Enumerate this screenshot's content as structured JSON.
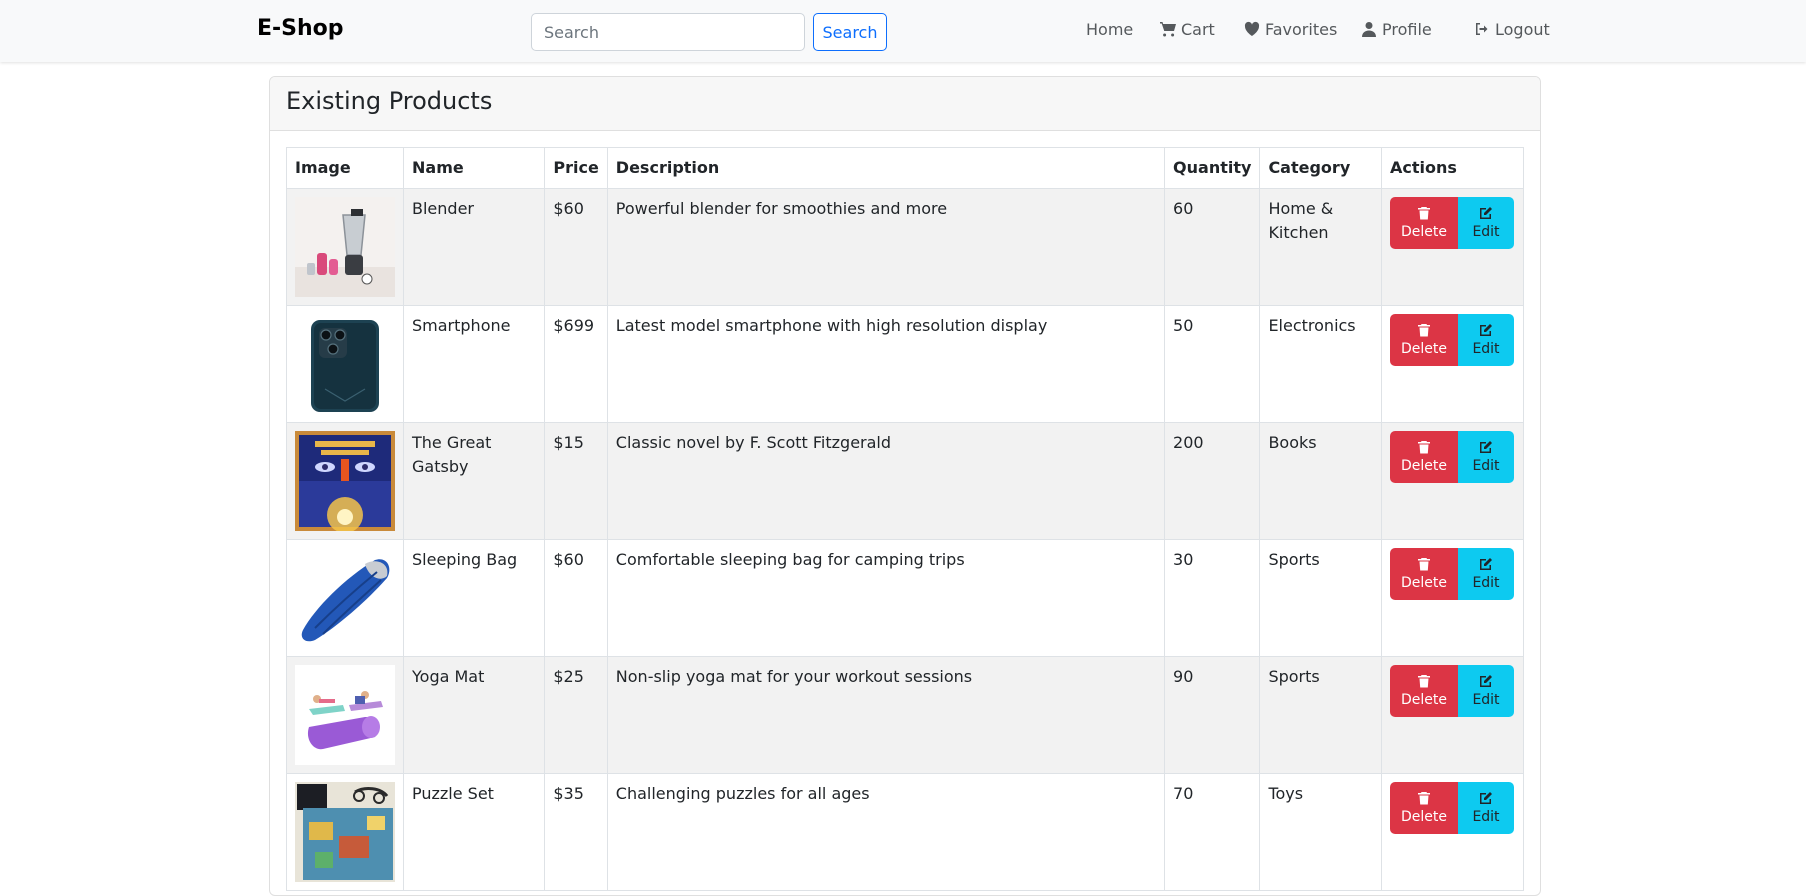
{
  "navbar": {
    "brand": "E-Shop",
    "search_placeholder": "Search",
    "search_button": "Search",
    "links": {
      "home": "Home",
      "cart": "Cart",
      "favorites": "Favorites",
      "profile": "Profile",
      "logout": "Logout"
    }
  },
  "products_card": {
    "title": "Existing Products",
    "columns": [
      "Image",
      "Name",
      "Price",
      "Description",
      "Quantity",
      "Category",
      "Actions"
    ],
    "delete_label": "Delete",
    "edit_label": "Edit",
    "rows": [
      {
        "name": "Blender",
        "price": "$60",
        "description": "Powerful blender for smoothies and more",
        "quantity": "60",
        "category": "Home & Kitchen",
        "image": "blender-photo"
      },
      {
        "name": "Smartphone",
        "price": "$699",
        "description": "Latest model smartphone with high resolution display",
        "quantity": "50",
        "category": "Electronics",
        "image": "smartphone-photo"
      },
      {
        "name": "The Great Gatsby",
        "price": "$15",
        "description": "Classic novel by F. Scott Fitzgerald",
        "quantity": "200",
        "category": "Books",
        "image": "book-cover-photo"
      },
      {
        "name": "Sleeping Bag",
        "price": "$60",
        "description": "Comfortable sleeping bag for camping trips",
        "quantity": "30",
        "category": "Sports",
        "image": "sleeping-bag-photo"
      },
      {
        "name": "Yoga Mat",
        "price": "$25",
        "description": "Non-slip yoga mat for your workout sessions",
        "quantity": "90",
        "category": "Sports",
        "image": "yoga-mat-photo"
      },
      {
        "name": "Puzzle Set",
        "price": "$35",
        "description": "Challenging puzzles for all ages",
        "quantity": "70",
        "category": "Toys",
        "image": "puzzle-photo"
      }
    ]
  },
  "colors": {
    "delete": "#dc3545",
    "edit": "#0dcaf0",
    "primary": "#0d6efd",
    "navbar_bg": "#f8f9fa"
  }
}
